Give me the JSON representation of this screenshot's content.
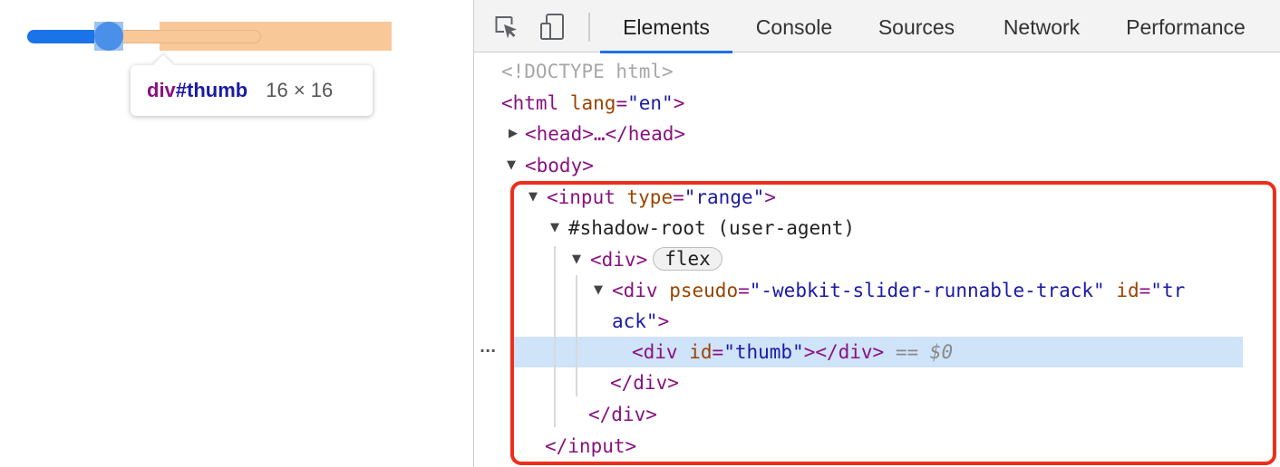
{
  "slider": {
    "value_fraction": 0.35
  },
  "tooltip": {
    "tag": "div",
    "id": "#thumb",
    "size": "16 × 16"
  },
  "toolbar": {
    "tabs": [
      {
        "label": "Elements",
        "active": true
      },
      {
        "label": "Console",
        "active": false
      },
      {
        "label": "Sources",
        "active": false
      },
      {
        "label": "Network",
        "active": false
      },
      {
        "label": "Performance",
        "active": false
      }
    ],
    "icons": [
      "inspect-element-icon",
      "device-toggle-icon"
    ]
  },
  "dom": {
    "doctype": "<!DOCTYPE html>",
    "html_open": "<html",
    "html_attr": "lang",
    "html_attr_val": "\"en\"",
    "html_close_bracket": ">",
    "head": "<head>…</head>",
    "body_open": "<body>",
    "input_open": "<input",
    "input_attr": "type",
    "input_attr_val": "\"range\"",
    "input_close_bracket": ">",
    "shadow_root": "#shadow-root (user-agent)",
    "div_open": "<div>",
    "flex_badge": "flex",
    "track_open": "<div",
    "track_attr1": "pseudo",
    "track_attr1_val": "\"-webkit-slider-runnable-track\"",
    "track_attr2": "id",
    "track_attr2_val_part1": "\"tr",
    "track_attr2_val_part2": "ack\"",
    "track_close_bracket": ">",
    "thumb_open": "<div",
    "thumb_attr": "id",
    "thumb_attr_val": "\"thumb\"",
    "thumb_close": "></div>",
    "selected_marker": "== $0",
    "row_ellipsis": "···",
    "div_close_inner": "</div>",
    "div_close_outer": "</div>",
    "input_close": "</input>"
  },
  "colors": {
    "tag": "#881280",
    "attr_name": "#994500",
    "attr_value": "#1a1aa6",
    "active_tab_underline": "#1a73e8",
    "selection_bg": "#cfe3f9",
    "annotation_border": "#ee2e1c",
    "slider_fill": "#1a73e8",
    "inspect_overlay": "#f9c898"
  }
}
